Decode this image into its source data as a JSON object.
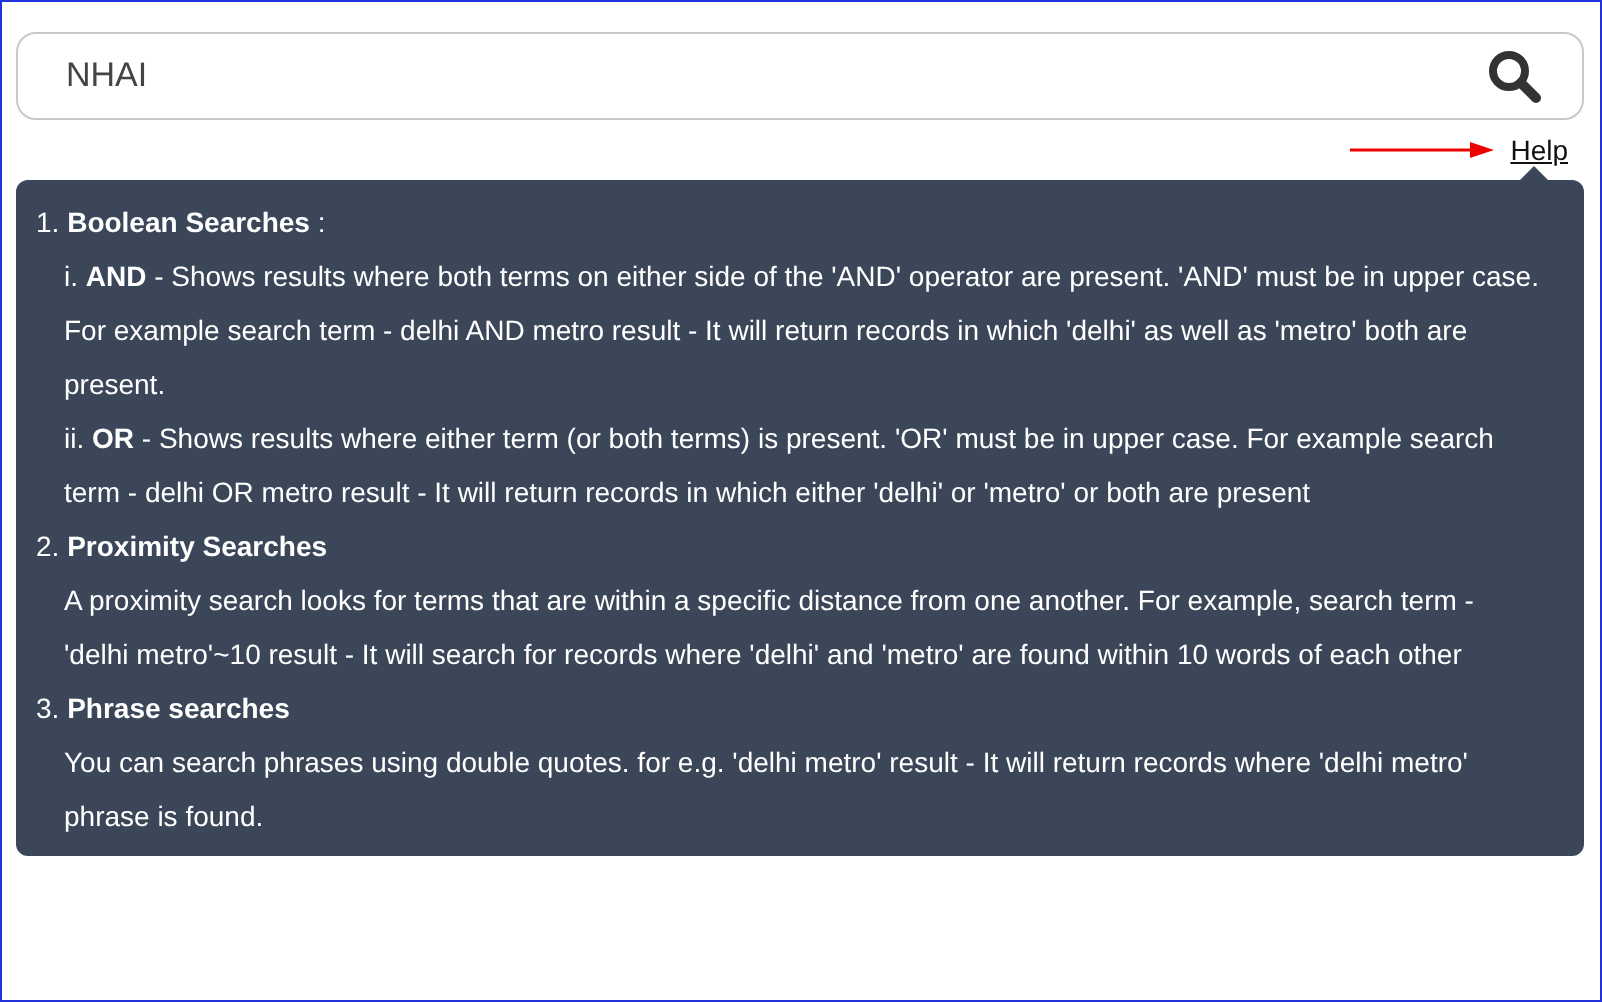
{
  "search": {
    "value": "NHAI"
  },
  "help_link": "Help",
  "help_panel": {
    "sections": [
      {
        "heading": "1. **Boolean Searches** :",
        "paragraphs": [
          "i. **AND** - Shows results where both terms on either side of the 'AND' operator are present. 'AND' must be in upper case. For example search term - delhi AND metro result - It will return records in which 'delhi' as well as 'metro' both are present.",
          "ii. **OR** - Shows results where either term (or both terms) is present. 'OR' must be in upper case. For example search term - delhi OR metro result - It will return records in which either 'delhi' or 'metro' or both are present"
        ]
      },
      {
        "heading": "2. **Proximity Searches**",
        "paragraphs": [
          "A proximity search looks for terms that are within a specific distance from one another. For example, search term - 'delhi metro'~10 result - It will search for records where 'delhi' and 'metro' are found within 10 words of each other"
        ]
      },
      {
        "heading": "3. **Phrase searches**",
        "paragraphs": [
          "You can search phrases using double quotes. for e.g. 'delhi metro' result - It will return records where 'delhi metro' phrase is found."
        ]
      }
    ]
  }
}
